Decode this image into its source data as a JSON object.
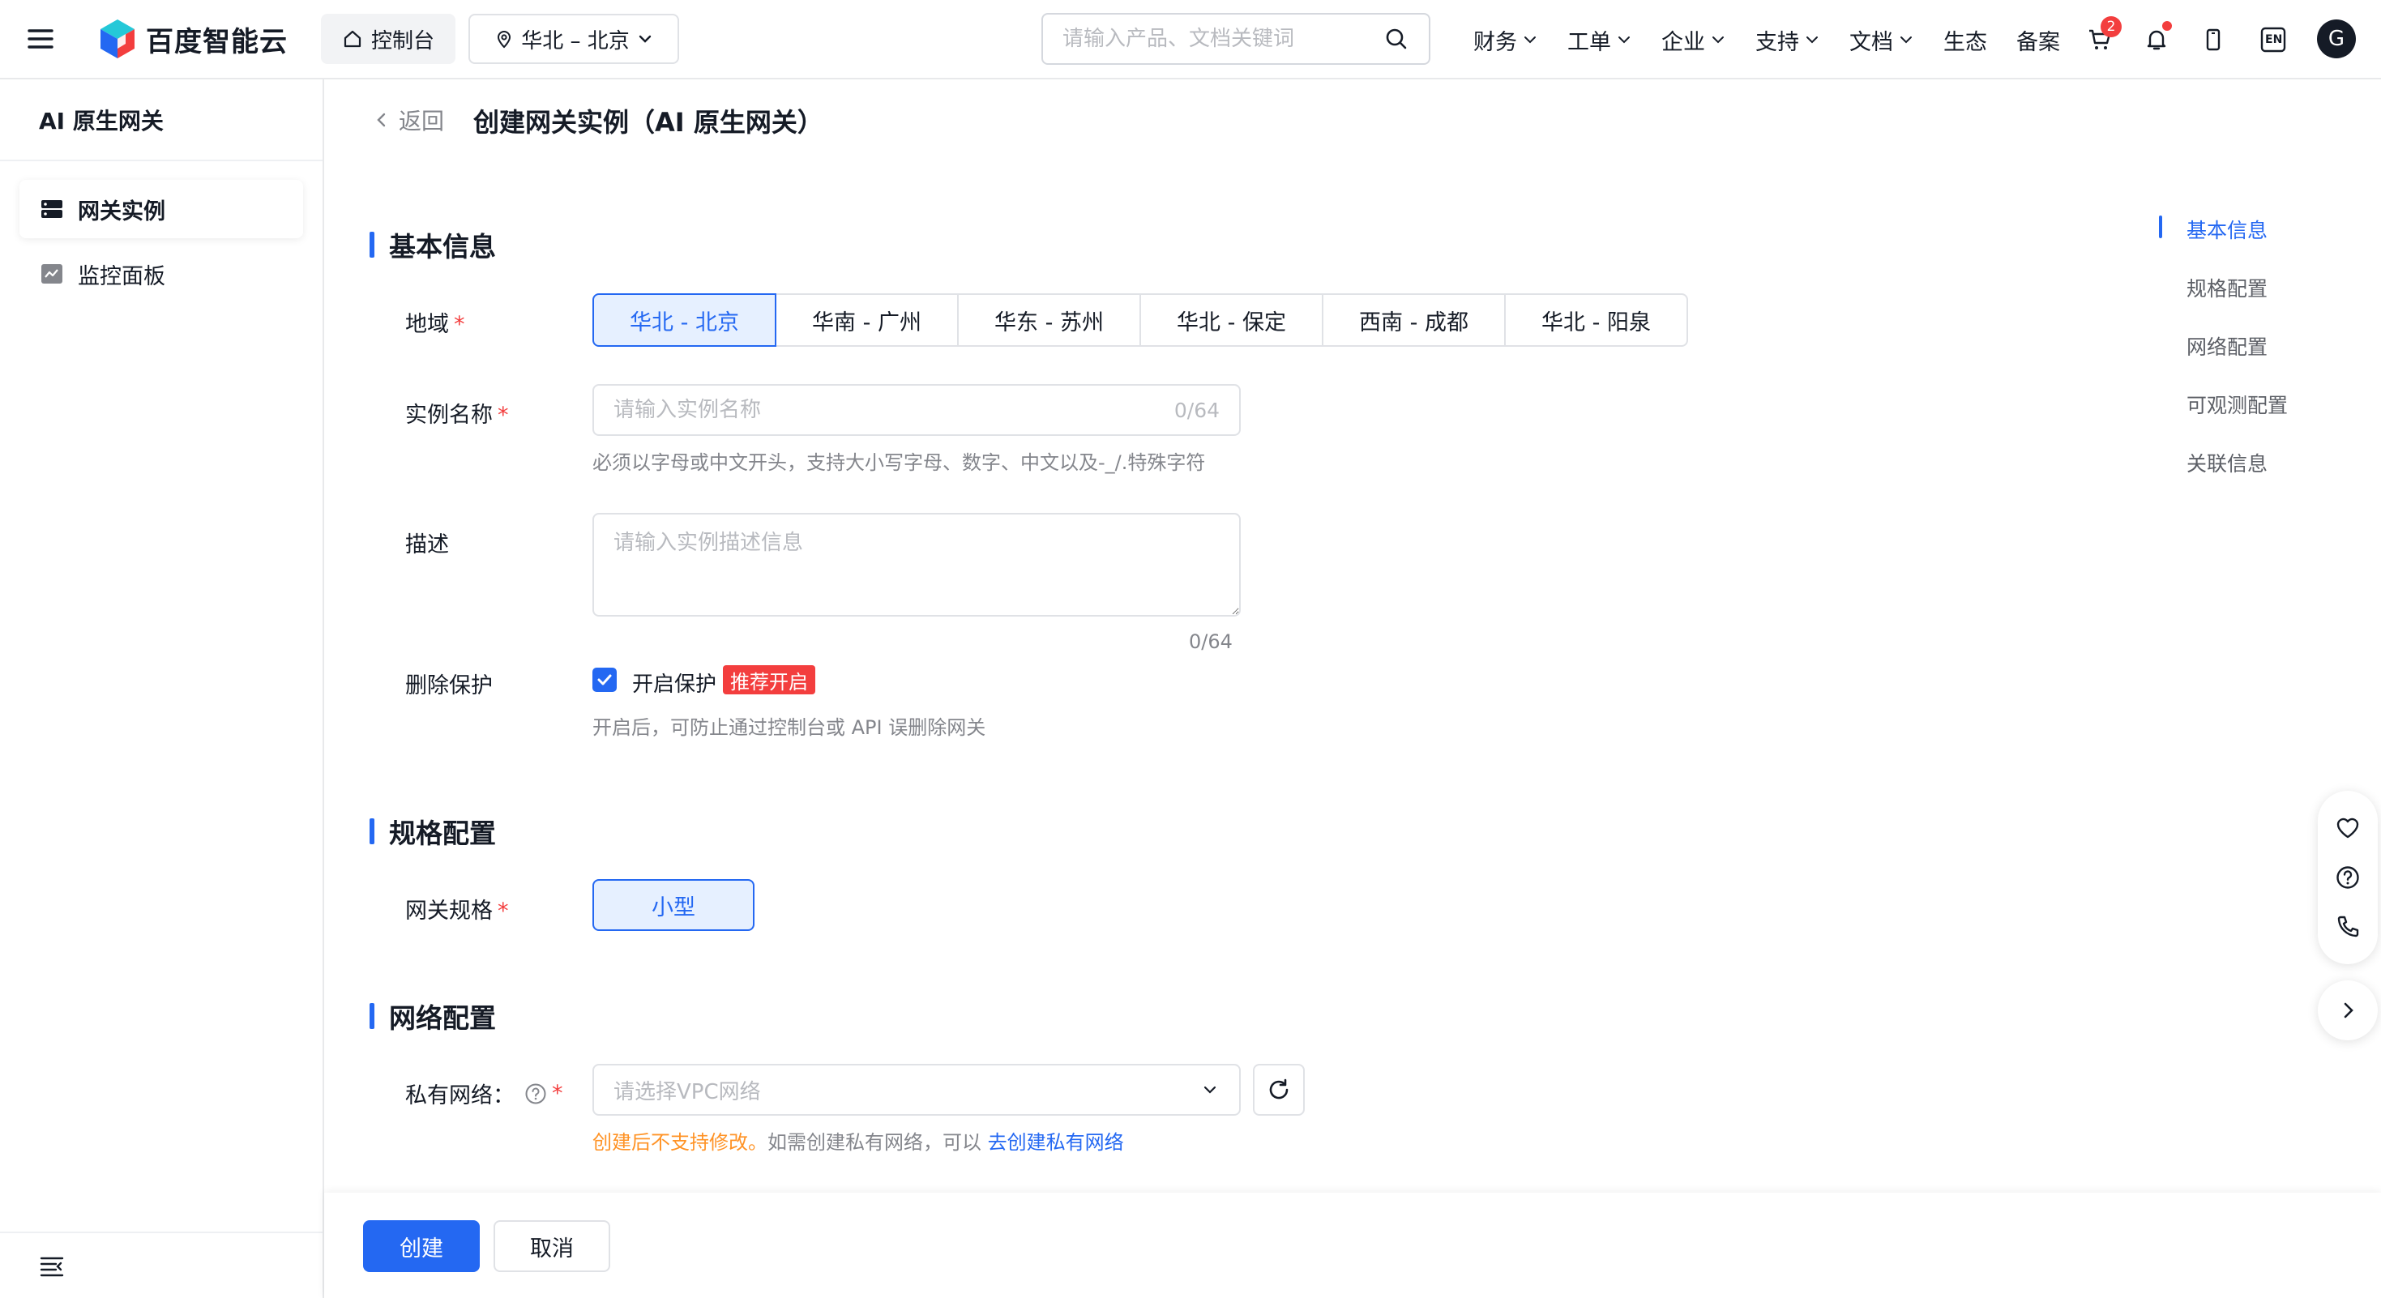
{
  "header": {
    "logo_text": "百度智能云",
    "console_label": "控制台",
    "region_label": "华北 – 北京",
    "search_placeholder": "请输入产品、文档关键词",
    "nav": [
      {
        "label": "财务",
        "dropdown": true
      },
      {
        "label": "工单",
        "dropdown": true
      },
      {
        "label": "企业",
        "dropdown": true
      },
      {
        "label": "支持",
        "dropdown": true
      },
      {
        "label": "文档",
        "dropdown": true
      },
      {
        "label": "生态",
        "dropdown": false
      },
      {
        "label": "备案",
        "dropdown": false
      }
    ],
    "cart_count": "2",
    "lang_label": "EN",
    "avatar_letter": "G"
  },
  "sidebar": {
    "title": "AI 原生网关",
    "items": [
      {
        "label": "网关实例",
        "icon": "server-icon",
        "active": true
      },
      {
        "label": "监控面板",
        "icon": "monitor-icon",
        "active": false
      }
    ]
  },
  "page": {
    "back_label": "返回",
    "title": "创建网关实例（AI 原生网关）"
  },
  "basic": {
    "section_title": "基本信息",
    "region": {
      "label": "地域",
      "options": [
        "华北 - 北京",
        "华南 - 广州",
        "华东 - 苏州",
        "华北 - 保定",
        "西南 - 成都",
        "华北 - 阳泉"
      ],
      "selected": "华北 - 北京"
    },
    "name": {
      "label": "实例名称",
      "placeholder": "请输入实例名称",
      "value": "",
      "counter": "0/64",
      "hint": "必须以字母或中文开头，支持大小写字母、数字、中文以及-_/.特殊字符"
    },
    "desc": {
      "label": "描述",
      "placeholder": "请输入实例描述信息",
      "value": "",
      "counter": "0/64"
    },
    "protect": {
      "label": "删除保护",
      "checkbox_label": "开启保护",
      "checked": true,
      "tag": "推荐开启",
      "hint": "开启后，可防止通过控制台或 API 误删除网关"
    }
  },
  "spec": {
    "section_title": "规格配置",
    "label": "网关规格",
    "selected": "小型"
  },
  "network": {
    "section_title": "网络配置",
    "label": "私有网络：",
    "placeholder": "请选择VPC网络",
    "hint_warn": "创建后不支持修改。",
    "hint_text": "如需创建私有网络，可以",
    "hint_link": "去创建私有网络"
  },
  "anchors": [
    {
      "label": "基本信息",
      "active": true
    },
    {
      "label": "规格配置",
      "active": false
    },
    {
      "label": "网络配置",
      "active": false
    },
    {
      "label": "可观测配置",
      "active": false
    },
    {
      "label": "关联信息",
      "active": false
    }
  ],
  "footer": {
    "create_label": "创建",
    "cancel_label": "取消"
  },
  "colors": {
    "primary": "#2468f2",
    "danger": "#f33e3e",
    "warning": "#ff9326"
  }
}
